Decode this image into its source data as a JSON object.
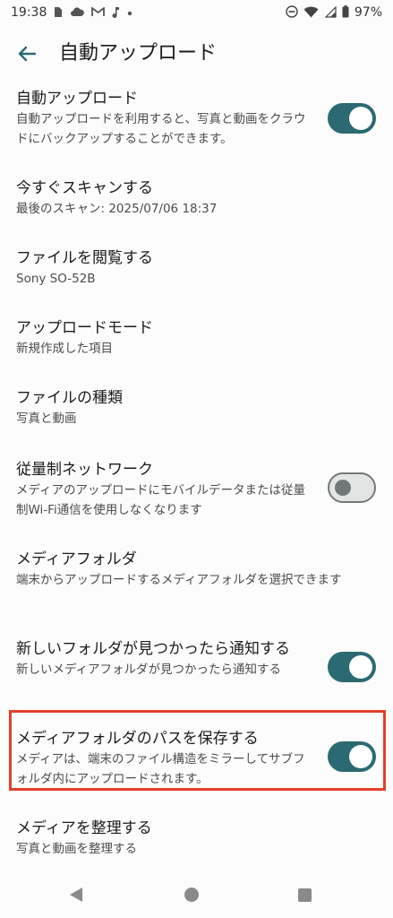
{
  "status_bar": {
    "time": "19:38",
    "battery": "97%",
    "left_icons": [
      "sim-icon",
      "cloud-icon",
      "gmail-icon",
      "music-note-icon",
      "dot-icon"
    ],
    "right_icons": [
      "do-not-disturb-icon",
      "wifi-icon",
      "signal-icon",
      "battery-icon"
    ]
  },
  "appbar": {
    "title": "自動アップロード"
  },
  "settings": [
    {
      "title": "自動アップロード",
      "subtitle": "自動アップロードを利用すると、写真と動画をクラウドにバックアップすることができます。",
      "toggle": true
    },
    {
      "title": "今すぐスキャンする",
      "subtitle": "最後のスキャン: 2025/07/06 18:37"
    },
    {
      "title": "ファイルを閲覧する",
      "subtitle": "Sony SO-52B"
    },
    {
      "title": "アップロードモード",
      "subtitle": "新規作成した項目"
    },
    {
      "title": "ファイルの種類",
      "subtitle": "写真と動画"
    },
    {
      "title": "従量制ネットワーク",
      "subtitle": "メディアのアップロードにモバイルデータまたは従量制Wi-Fi通信を使用しなくなります",
      "toggle": false
    },
    {
      "title": "メディアフォルダ",
      "subtitle": "端末からアップロードするメディアフォルダを選択できます"
    },
    {
      "title": "新しいフォルダが見つかったら通知する",
      "subtitle": "新しいメディアフォルダが見つかったら通知する",
      "toggle": true
    },
    {
      "title": "メディアフォルダのパスを保存する",
      "subtitle": "メディアは、端末のファイル構造をミラーしてサブフォルダ内にアップロードされます。",
      "toggle": true
    },
    {
      "title": "メディアを整理する",
      "subtitle": "写真と動画を整理する"
    }
  ],
  "colors": {
    "accent": "#2b6a72",
    "highlight": "#e2402a"
  }
}
